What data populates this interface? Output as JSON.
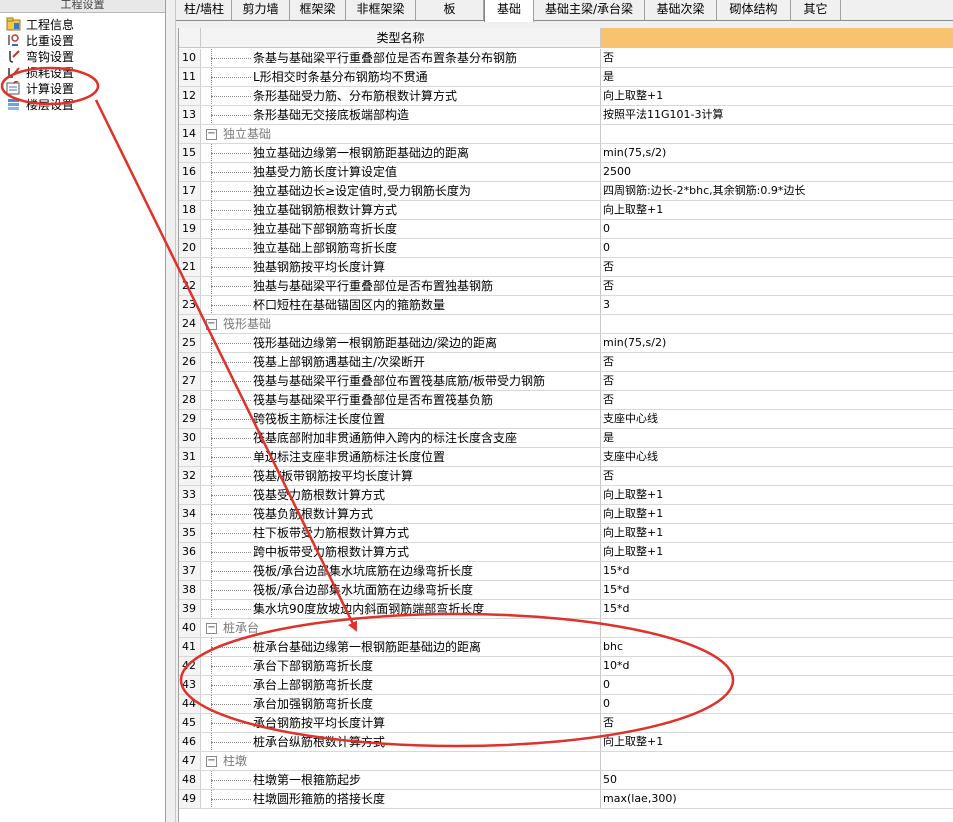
{
  "left_panel": {
    "title": "工程设置",
    "items": [
      {
        "label": "工程信息",
        "icon": "folder-info-icon"
      },
      {
        "label": "比重设置",
        "icon": "weight-icon"
      },
      {
        "label": "弯钩设置",
        "icon": "hook-icon"
      },
      {
        "label": "损耗设置",
        "icon": "loss-icon"
      },
      {
        "label": "计算设置",
        "icon": "calculator-settings-icon"
      },
      {
        "label": "楼层设置",
        "icon": "floor-stack-icon"
      }
    ]
  },
  "tabs": [
    "柱/墙柱",
    "剪力墙",
    "框架梁",
    "非框架梁",
    "板",
    "基础",
    "基础主梁/承台梁",
    "基础次梁",
    "砌体结构",
    "其它"
  ],
  "active_tab": "基础",
  "grid": {
    "header": "类型名称",
    "rows": [
      {
        "num": "10",
        "name": "条基与基础梁平行重叠部位是否布置条基分布钢筋",
        "value": "否"
      },
      {
        "num": "11",
        "name": "L形相交时条基分布钢筋均不贯通",
        "value": "是"
      },
      {
        "num": "12",
        "name": "条形基础受力筋、分布筋根数计算方式",
        "value": "向上取整+1"
      },
      {
        "num": "13",
        "name": "条形基础无交接底板端部构造",
        "value": "按照平法11G101-3计算"
      },
      {
        "num": "14",
        "name": "独立基础",
        "value": "",
        "group": true
      },
      {
        "num": "15",
        "name": "独立基础边缘第一根钢筋距基础边的距离",
        "value": "min(75,s/2)"
      },
      {
        "num": "16",
        "name": "独基受力筋长度计算设定值",
        "value": "2500"
      },
      {
        "num": "17",
        "name": "独立基础边长≥设定值时,受力钢筋长度为",
        "value": "四周钢筋:边长-2*bhc,其余钢筋:0.9*边长"
      },
      {
        "num": "18",
        "name": "独立基础钢筋根数计算方式",
        "value": "向上取整+1"
      },
      {
        "num": "19",
        "name": "独立基础下部钢筋弯折长度",
        "value": "0"
      },
      {
        "num": "20",
        "name": "独立基础上部钢筋弯折长度",
        "value": "0"
      },
      {
        "num": "21",
        "name": "独基钢筋按平均长度计算",
        "value": "否"
      },
      {
        "num": "22",
        "name": "独基与基础梁平行重叠部位是否布置独基钢筋",
        "value": "否"
      },
      {
        "num": "23",
        "name": "杯口短柱在基础锚固区内的箍筋数量",
        "value": "3"
      },
      {
        "num": "24",
        "name": "筏形基础",
        "value": "",
        "group": true
      },
      {
        "num": "25",
        "name": "筏形基础边缘第一根钢筋距基础边/梁边的距离",
        "value": "min(75,s/2)"
      },
      {
        "num": "26",
        "name": "筏基上部钢筋遇基础主/次梁断开",
        "value": "否"
      },
      {
        "num": "27",
        "name": "筏基与基础梁平行重叠部位布置筏基底筋/板带受力钢筋",
        "value": "否"
      },
      {
        "num": "28",
        "name": "筏基与基础梁平行重叠部位是否布置筏基负筋",
        "value": "否"
      },
      {
        "num": "29",
        "name": "跨筏板主筋标注长度位置",
        "value": "支座中心线"
      },
      {
        "num": "30",
        "name": "筏基底部附加非贯通筋伸入跨内的标注长度含支座",
        "value": "是"
      },
      {
        "num": "31",
        "name": "单边标注支座非贯通筋标注长度位置",
        "value": "支座中心线"
      },
      {
        "num": "32",
        "name": "筏基/板带钢筋按平均长度计算",
        "value": "否"
      },
      {
        "num": "33",
        "name": "筏基受力筋根数计算方式",
        "value": "向上取整+1"
      },
      {
        "num": "34",
        "name": "筏基负筋根数计算方式",
        "value": "向上取整+1"
      },
      {
        "num": "35",
        "name": "柱下板带受力筋根数计算方式",
        "value": "向上取整+1"
      },
      {
        "num": "36",
        "name": "跨中板带受力筋根数计算方式",
        "value": "向上取整+1"
      },
      {
        "num": "37",
        "name": "筏板/承台边部集水坑底筋在边缘弯折长度",
        "value": "15*d"
      },
      {
        "num": "38",
        "name": "筏板/承台边部集水坑面筋在边缘弯折长度",
        "value": "15*d"
      },
      {
        "num": "39",
        "name": "集水坑90度放坡边内斜面钢筋端部弯折长度",
        "value": "15*d"
      },
      {
        "num": "40",
        "name": "桩承台",
        "value": "",
        "group": true
      },
      {
        "num": "41",
        "name": "桩承台基础边缘第一根钢筋距基础边的距离",
        "value": "bhc"
      },
      {
        "num": "42",
        "name": "承台下部钢筋弯折长度",
        "value": "10*d"
      },
      {
        "num": "43",
        "name": "承台上部钢筋弯折长度",
        "value": "0"
      },
      {
        "num": "44",
        "name": "承台加强钢筋弯折长度",
        "value": "0"
      },
      {
        "num": "45",
        "name": "承台钢筋按平均长度计算",
        "value": "否"
      },
      {
        "num": "46",
        "name": "桩承台纵筋根数计算方式",
        "value": "向上取整+1"
      },
      {
        "num": "47",
        "name": "柱墩",
        "value": "",
        "group": true
      },
      {
        "num": "48",
        "name": "柱墩第一根箍筋起步",
        "value": "50"
      },
      {
        "num": "49",
        "name": "柱墩圆形箍筋的搭接长度",
        "value": "max(lae,300)"
      }
    ]
  },
  "colors": {
    "header_value_bg": "#f7c36e",
    "annotation": "#e0312a"
  }
}
